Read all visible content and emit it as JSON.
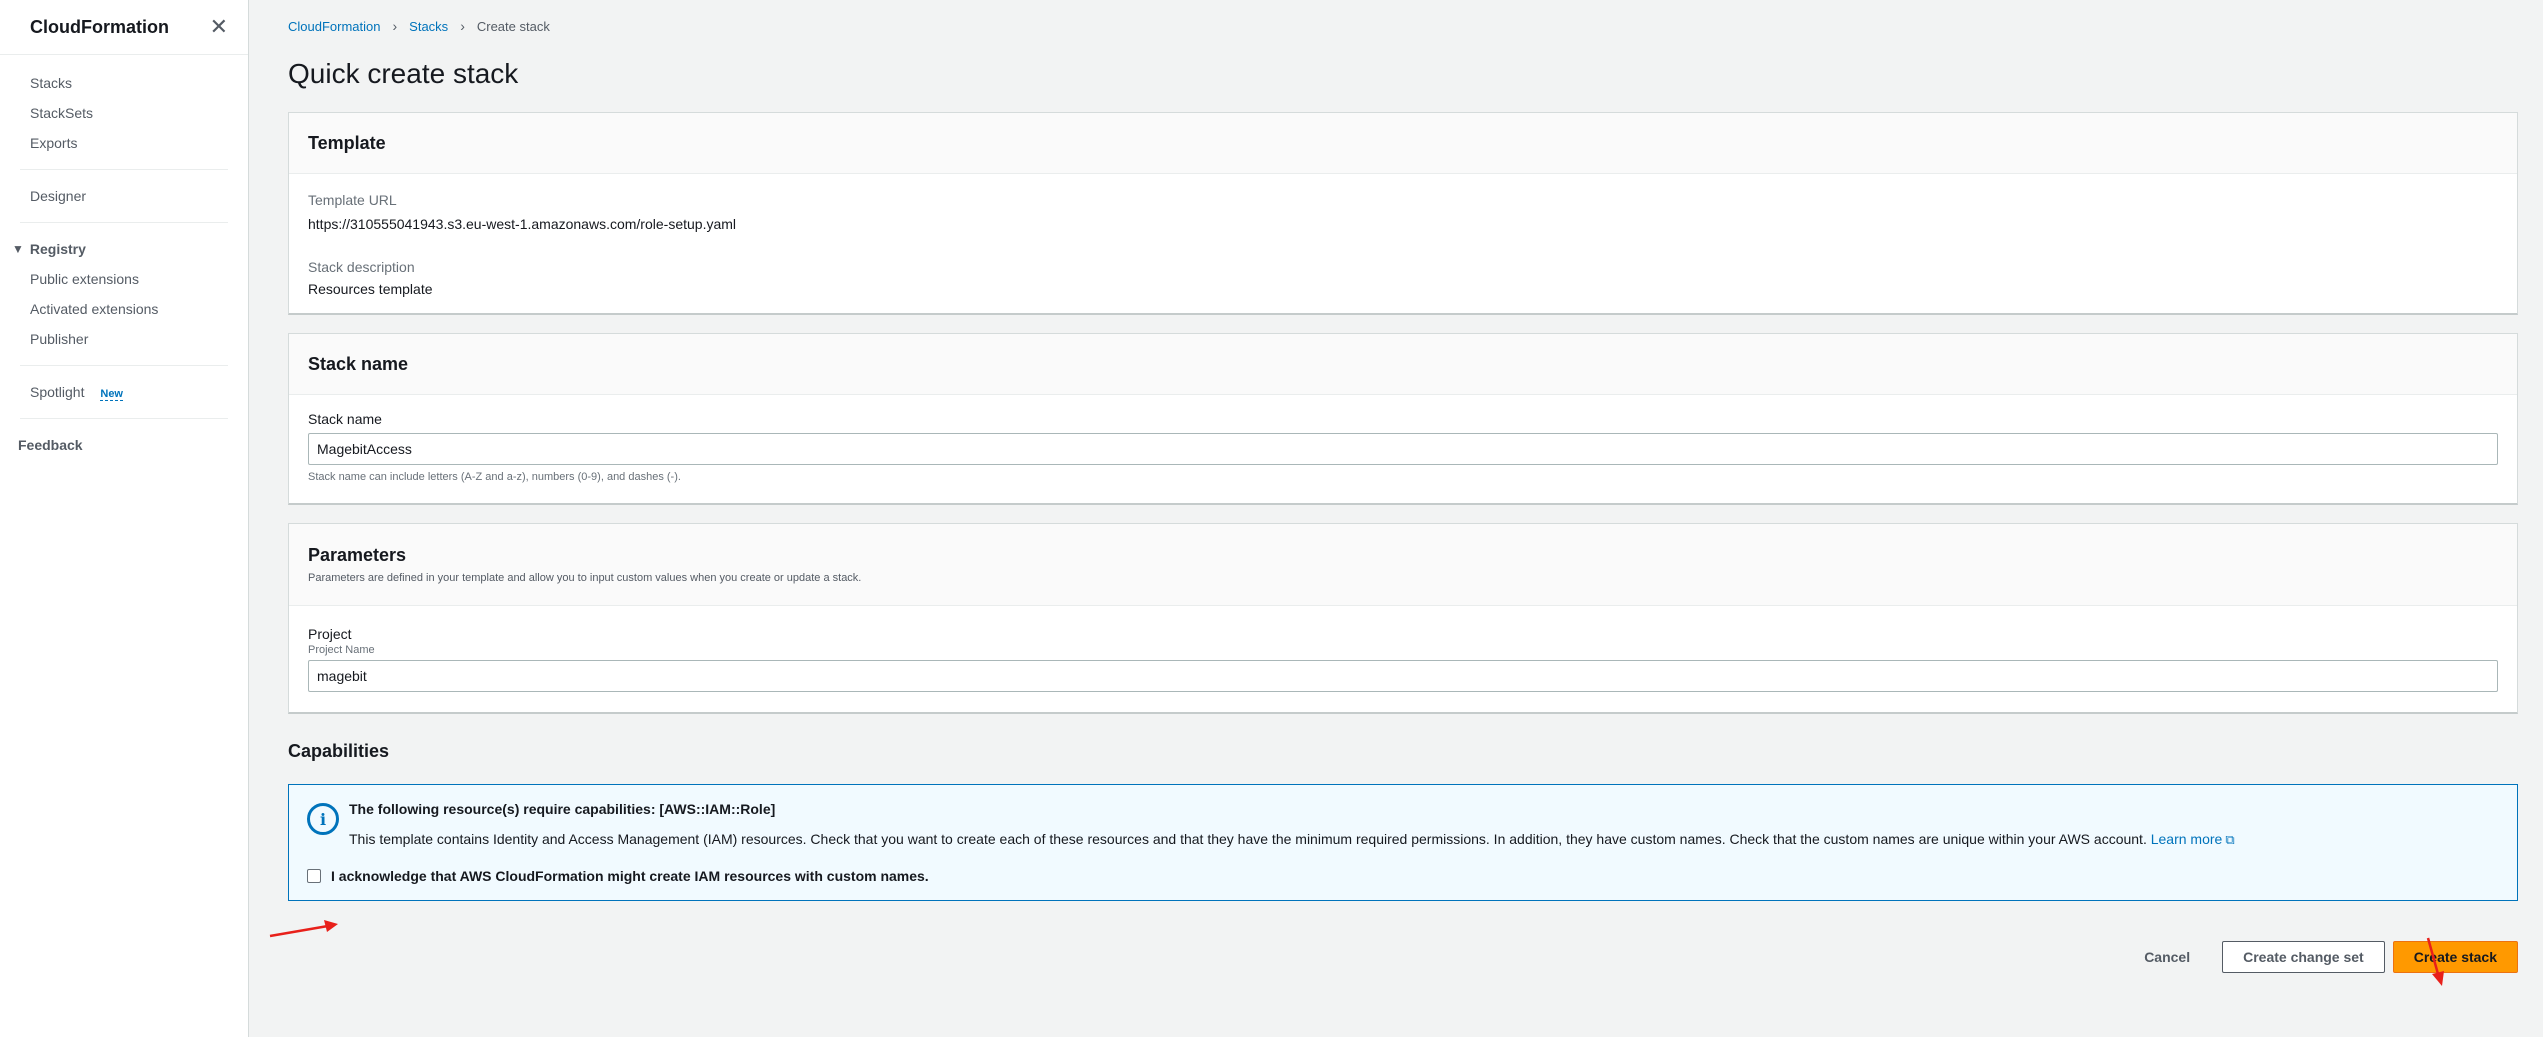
{
  "sidebar": {
    "title": "CloudFormation",
    "nav": [
      "Stacks",
      "StackSets",
      "Exports"
    ],
    "designer": "Designer",
    "registry": {
      "label": "Registry",
      "items": [
        "Public extensions",
        "Activated extensions",
        "Publisher"
      ]
    },
    "spotlight": "Spotlight",
    "spotlight_badge": "New",
    "feedback": "Feedback"
  },
  "breadcrumb": {
    "items": [
      "CloudFormation",
      "Stacks"
    ],
    "current": "Create stack"
  },
  "page_title": "Quick create stack",
  "template_panel": {
    "title": "Template",
    "url_label": "Template URL",
    "url_value": "https://310555041943.s3.eu-west-1.amazonaws.com/role-setup.yaml",
    "desc_label": "Stack description",
    "desc_value": "Resources template"
  },
  "stack_name_panel": {
    "title": "Stack name",
    "label": "Stack name",
    "value": "MagebitAccess",
    "hint": "Stack name can include letters (A-Z and a-z), numbers (0-9), and dashes (-)."
  },
  "parameters_panel": {
    "title": "Parameters",
    "subtitle": "Parameters are defined in your template and allow you to input custom values when you create or update a stack.",
    "param_label": "Project",
    "param_sub": "Project Name",
    "param_value": "magebit"
  },
  "capabilities": {
    "heading": "Capabilities",
    "alert_title": "The following resource(s) require capabilities: [AWS::IAM::Role]",
    "alert_text": "This template contains Identity and Access Management (IAM) resources. Check that you want to create each of these resources and that they have the minimum required permissions. In addition, they have custom names. Check that the custom names are unique within your AWS account.",
    "learn_more": "Learn more",
    "ack_label": "I acknowledge that AWS CloudFormation might create IAM resources with custom names."
  },
  "footer": {
    "cancel": "Cancel",
    "change_set": "Create change set",
    "create": "Create stack"
  },
  "colors": {
    "accent": "#0073bb",
    "primary_button": "#ff9900",
    "annotation_arrow": "#e8201a"
  }
}
